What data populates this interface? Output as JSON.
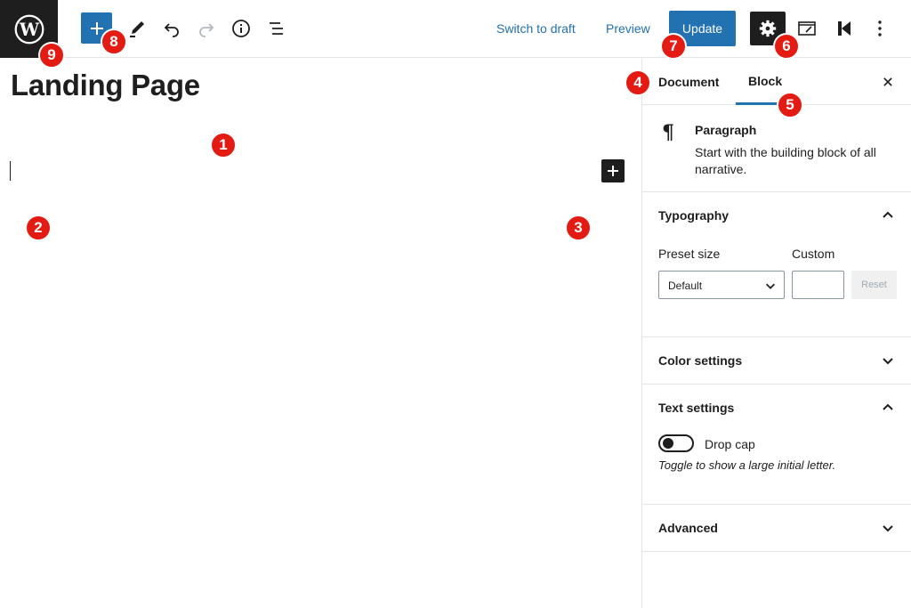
{
  "toolbar": {
    "switch_to_draft": "Switch to draft",
    "preview": "Preview",
    "update": "Update",
    "accent_color": "#2271b1"
  },
  "editor": {
    "title": "Landing Page"
  },
  "sidebar": {
    "tabs": [
      {
        "label": "Document"
      },
      {
        "label": "Block",
        "active": true
      }
    ],
    "block": {
      "name": "Paragraph",
      "description": "Start with the building block of all narrative."
    },
    "typography": {
      "title": "Typography",
      "preset_label": "Preset size",
      "preset_value": "Default",
      "custom_label": "Custom",
      "custom_value": "",
      "reset_label": "Reset",
      "expanded": true
    },
    "color_settings": {
      "title": "Color settings",
      "expanded": false
    },
    "text_settings": {
      "title": "Text settings",
      "expanded": true,
      "drop_cap_label": "Drop cap",
      "drop_cap_help": "Toggle to show a large initial letter.",
      "drop_cap_on": false
    },
    "advanced": {
      "title": "Advanced",
      "expanded": false
    }
  },
  "badges": [
    "1",
    "2",
    "3",
    "4",
    "5",
    "6",
    "7",
    "8",
    "9"
  ],
  "icons": [
    "wordpress-logo-icon",
    "plus-icon",
    "pencil-icon",
    "undo-icon",
    "redo-icon",
    "info-icon",
    "list-view-icon",
    "gear-icon",
    "sidebar-square-icon",
    "k-logo-icon",
    "more-vertical-icon",
    "close-icon",
    "pilcrow-icon",
    "chevron-up-icon",
    "chevron-down-icon"
  ],
  "badge_color": "#e41b13"
}
